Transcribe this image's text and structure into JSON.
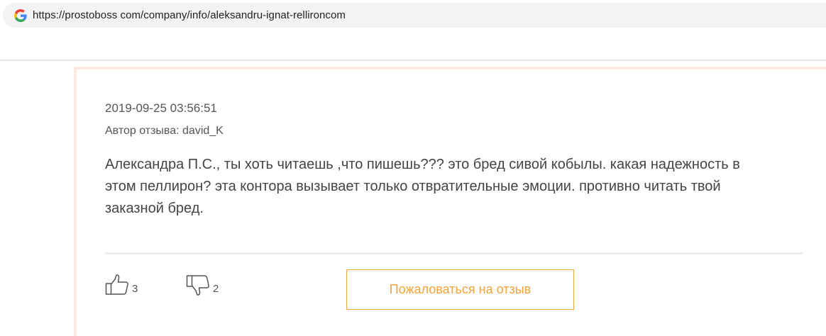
{
  "browser": {
    "url": "https://prostoboss com/company/info/aleksandru-ignat-rellironcom",
    "favicon": "google-g-icon"
  },
  "review": {
    "date": "2019-09-25 03:56:51",
    "author": "Автор отзыва: david_K",
    "text": "Александра П.С., ты хоть читаешь ,что пишешь??? это бред сивой кобылы. какая надежность в этом пеллирон? эта контора вызывает только отвратительные эмоции. противно читать твой заказной бред.",
    "likes": "3",
    "dislikes": "2",
    "complain_label": "Пожаловаться на отзыв"
  },
  "colors": {
    "accent": "#f0a33a",
    "card_border": "#fde8e4"
  }
}
